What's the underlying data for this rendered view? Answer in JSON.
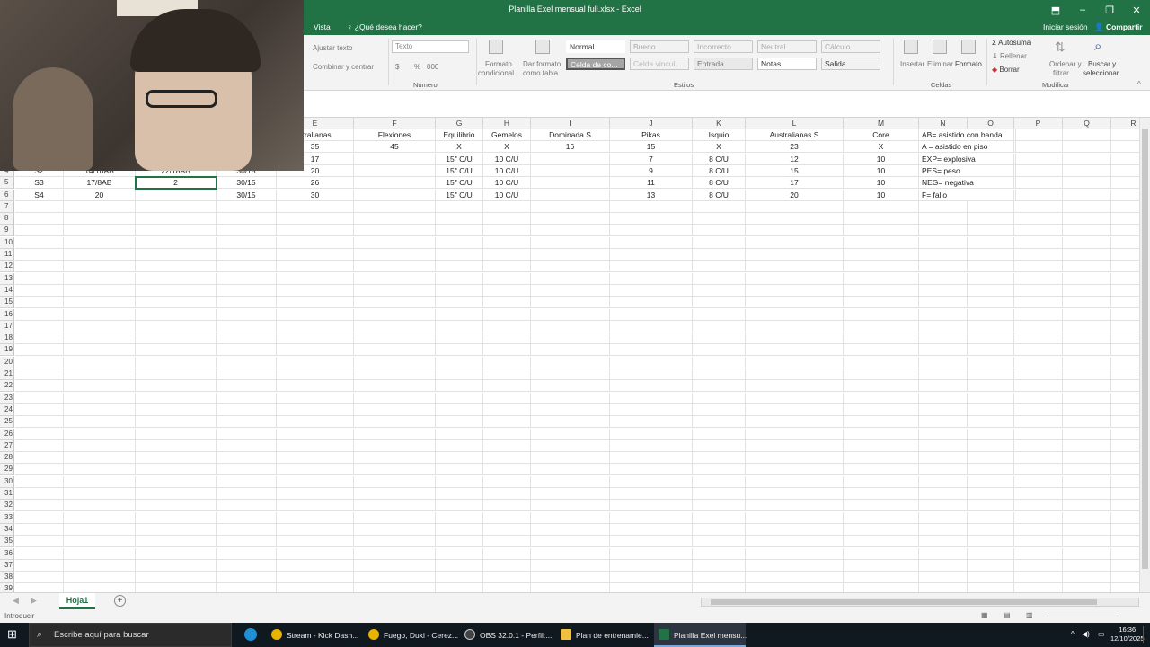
{
  "window": {
    "title": "Planilla Exel mensual full.xlsx - Excel"
  },
  "tabs": {
    "vista": "Vista",
    "tell_me": "¿Qué desea hacer?",
    "sign_in": "Iniciar sesión",
    "share": "Compartir"
  },
  "ribbon": {
    "ajustar_texto": "Ajustar texto",
    "combinar": "Combinar y centrar",
    "number_format": "Texto",
    "currency": "$",
    "percent": "%",
    "thousands": "000",
    "formato_condicional_1": "Formato",
    "formato_condicional_2": "condicional",
    "dar_formato_1": "Dar formato",
    "dar_formato_2": "como tabla",
    "styles": [
      "Normal",
      "Bueno",
      "Incorrecto",
      "Neutral",
      "Cálculo",
      "Celda de co...",
      "Celda vincul...",
      "Entrada",
      "Notas",
      "Salida"
    ],
    "insertar": "Insertar",
    "eliminar": "Eliminar",
    "formato": "Formato",
    "autosuma": "Autosuma",
    "rellenar": "Rellenar",
    "borrar": "Borrar",
    "ordenar_1": "Ordenar y",
    "ordenar_2": "filtrar",
    "buscar_1": "Buscar y",
    "buscar_2": "seleccionar",
    "group_numero": "Número",
    "group_estilos": "Estilos",
    "group_celdas": "Celdas",
    "group_modificar": "Modificar"
  },
  "columns": [
    "E",
    "F",
    "G",
    "H",
    "I",
    "J",
    "K",
    "L",
    "M",
    "N",
    "O",
    "P",
    "Q",
    "R"
  ],
  "header_row": [
    "stralianas",
    "Flexiones",
    "Equilibrio",
    "Gemelos",
    "Dominada S",
    "Pikas",
    "Isquio",
    "Australianas S",
    "Core",
    "AB= asistido con banda"
  ],
  "rows": [
    {
      "num": "",
      "a": "",
      "b": "",
      "c": "",
      "d": "",
      "e": "35",
      "f": "45",
      "g": "X",
      "h": "X",
      "i": "16",
      "j": "15",
      "k": "X",
      "l": "23",
      "m": "X",
      "n": "A = asistido en piso"
    },
    {
      "num": "",
      "a": "",
      "b": "",
      "c": "",
      "d": "",
      "e": "17",
      "f": "",
      "g": "15\" C/U",
      "h": "10 C/U",
      "i": "",
      "j": "7",
      "k": "8 C/U",
      "l": "12",
      "m": "10",
      "n": "EXP= explosiva"
    },
    {
      "num": "4",
      "a": "S2",
      "b": "14/10AB",
      "c": "22/18AB",
      "d": "30/15",
      "e": "20",
      "f": "",
      "g": "15\" C/U",
      "h": "10 C/U",
      "i": "",
      "j": "9",
      "k": "8 C/U",
      "l": "15",
      "m": "10",
      "n": "PES= peso"
    },
    {
      "num": "5",
      "a": "S3",
      "b": "17/8AB",
      "c": "2",
      "d": "30/15",
      "e": "26",
      "f": "",
      "g": "15\" C/U",
      "h": "10 C/U",
      "i": "",
      "j": "11",
      "k": "8 C/U",
      "l": "17",
      "m": "10",
      "n": "NEG= negativa"
    },
    {
      "num": "6",
      "a": "S4",
      "b": "20",
      "c": "",
      "d": "30/15",
      "e": "30",
      "f": "",
      "g": "15\" C/U",
      "h": "10 C/U",
      "i": "",
      "j": "13",
      "k": "8 C/U",
      "l": "20",
      "m": "10",
      "n": "F= fallo"
    }
  ],
  "empty_row_numbers": [
    "7",
    "8",
    "9",
    "10",
    "11",
    "12",
    "13",
    "14",
    "15",
    "16",
    "17",
    "18",
    "19",
    "20",
    "21",
    "22",
    "23",
    "24",
    "25",
    "26",
    "27",
    "28",
    "29",
    "30",
    "31",
    "32",
    "33",
    "34",
    "35",
    "36",
    "37",
    "38",
    "39"
  ],
  "sheet": {
    "tab_name": "Hoja1",
    "add": "+"
  },
  "status": {
    "mode": "Introducir"
  },
  "taskbar": {
    "search_placeholder": "Escribe aquí para buscar",
    "apps": [
      "Stream - Kick Dash...",
      "Fuego, Duki - Cerez...",
      "OBS 32.0.1 - Perfil:...",
      "Plan de entrenamie...",
      "Planilla Exel mensu..."
    ],
    "time": "16:36",
    "date": "12/10/2025"
  },
  "colors": {
    "excel_green": "#217346",
    "taskbar": "#101820"
  }
}
